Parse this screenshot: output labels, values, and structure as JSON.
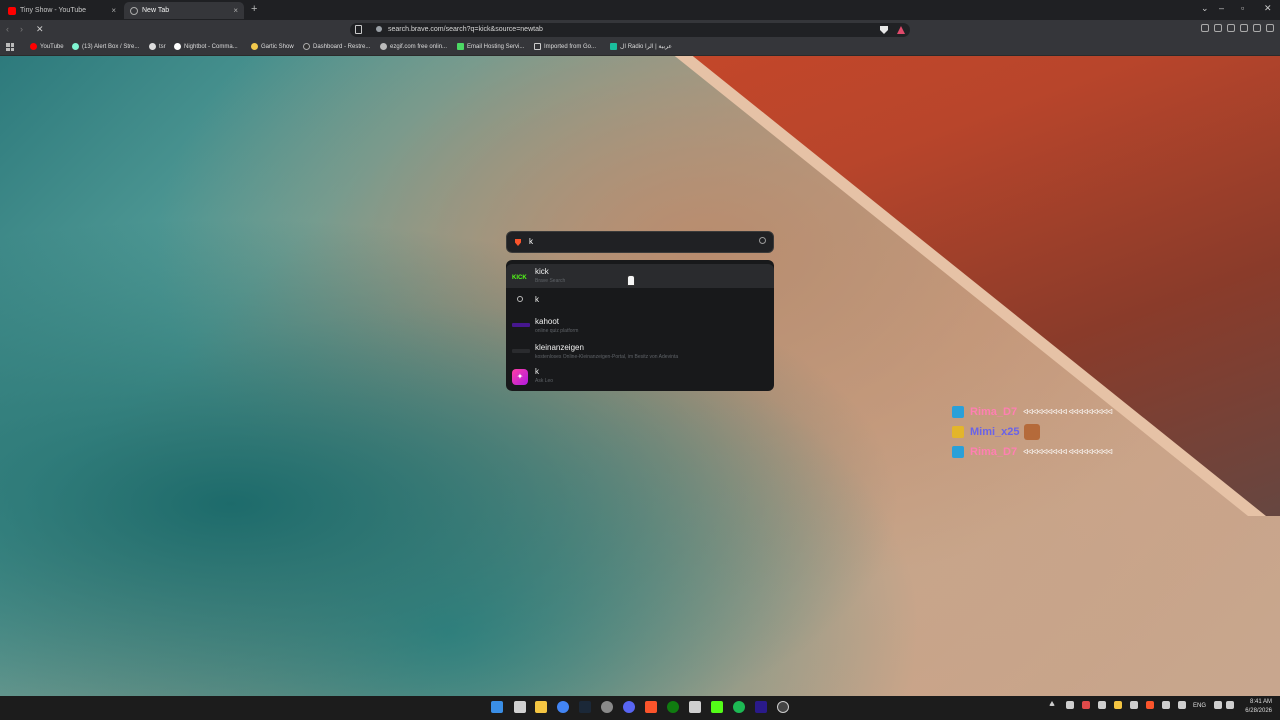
{
  "tabs": [
    {
      "title": "Tiny Show - YouTube",
      "active": false,
      "close": "×"
    },
    {
      "title": "New Tab",
      "active": true,
      "close": "×"
    }
  ],
  "new_tab_label": "+",
  "window_controls": {
    "chevron": "⌄",
    "minimize": "–",
    "maximize": "▫",
    "close": "✕"
  },
  "nav": {
    "back": "‹",
    "forward": "›",
    "stop": "✕"
  },
  "address_bar": {
    "url": "search.brave.com/search?q=kick&source=newtab"
  },
  "bookmarks": [
    "YouTube",
    "(13) Alert Box / Stre...",
    "tsr",
    "Nightbot - Comma...",
    "Gartic Show",
    "Dashboard - Restre...",
    "ezgif.com free onlin...",
    "Email Hosting Servi...",
    "Imported from Go...",
    "ال Radio عربية | الرا"
  ],
  "search": {
    "query": "k"
  },
  "suggestions": [
    {
      "title": "kick",
      "subtitle": "Brave Search",
      "icon": "kick-logo"
    },
    {
      "title": "k",
      "subtitle": "",
      "icon": "search-icon"
    },
    {
      "title": "kahoot",
      "subtitle": "online quiz platform",
      "icon": "kahoot-logo"
    },
    {
      "title": "kleinanzeigen",
      "subtitle": "kostenloses Online-Kleinanzeigen-Portal, im Besitz von Adevinta",
      "icon": "kleinanzeigen-logo"
    },
    {
      "title": "k",
      "subtitle": "Ask Leo",
      "icon": "leo-icon"
    }
  ],
  "chat": [
    {
      "user": "Rima_D7",
      "message": "ᐊᐊᐊᐊᐊᐊᐊᐊᐊ ᐊᐊᐊᐊᐊᐊᐊᐊᐊ",
      "badge": "blue",
      "color": "#ff7fb2",
      "emote": false
    },
    {
      "user": "Mimi_x25",
      "message": "",
      "badge": "gold",
      "color": "#6a63e8",
      "emote": true
    },
    {
      "user": "Rima_D7",
      "message": "ᐊᐊᐊᐊᐊᐊᐊᐊᐊ ᐊᐊᐊᐊᐊᐊᐊᐊᐊ",
      "badge": "blue",
      "color": "#ff7fb2",
      "emote": false
    }
  ],
  "taskbar": {
    "lang": "ENG",
    "time": "8:41 AM",
    "date": "6/28/2026"
  }
}
